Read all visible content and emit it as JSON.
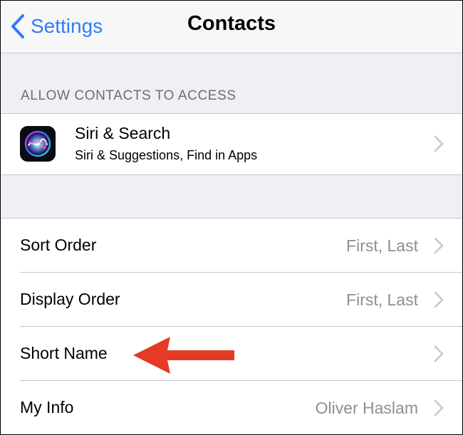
{
  "navbar": {
    "back_label": "Settings",
    "title": "Contacts"
  },
  "allow_section": {
    "header": "ALLOW CONTACTS TO ACCESS",
    "siri": {
      "title": "Siri & Search",
      "subtitle": "Siri & Suggestions, Find in Apps",
      "icon": "siri-icon"
    }
  },
  "settings": {
    "rows": [
      {
        "label": "Sort Order",
        "value": "First, Last"
      },
      {
        "label": "Display Order",
        "value": "First, Last"
      },
      {
        "label": "Short Name",
        "value": ""
      },
      {
        "label": "My Info",
        "value": "Oliver Haslam"
      }
    ]
  },
  "colors": {
    "accent": "#2f7cf6",
    "secondary_text": "#8e8e93",
    "group_background": "#efeff4",
    "annotation_arrow": "#e53a25"
  }
}
